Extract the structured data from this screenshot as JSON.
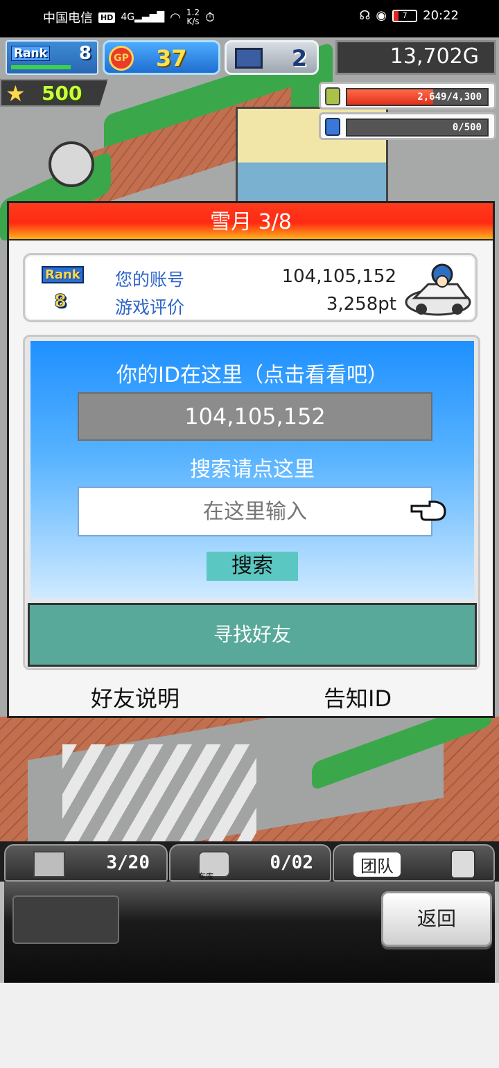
{
  "status_bar": {
    "carrier": "中国电信",
    "hd": "HD",
    "network": "4G",
    "speed": "1.2\nK/s",
    "battery": "7",
    "time": "20:22"
  },
  "hud": {
    "rank_label": "Rank",
    "rank_value": "8",
    "gp_label": "GP",
    "gp_value": "37",
    "pc_value": "2",
    "money": "13,702G",
    "star_value": "500",
    "resource_1": "2,649/4,300",
    "resource_2": "0/500",
    "resource_1_level": 0.616,
    "resource_2_level": 0
  },
  "dialog": {
    "title": "雪月 3/8",
    "rank_label": "Rank",
    "rank_value": "8",
    "account_label": "您的账号",
    "account_value": "104,105,152",
    "rating_label": "游戏评价",
    "rating_value": "3,258pt",
    "id_prompt": "你的ID在这里（点击看看吧）",
    "id_value": "104,105,152",
    "search_prompt": "搜索请点这里",
    "search_placeholder": "在这里输入",
    "search_button": "搜索",
    "find_friends_button": "寻找好友",
    "friend_info_link": "好友说明",
    "tell_id_link": "告知ID"
  },
  "bottom_bar": {
    "tab1_count": "3/20",
    "tab2_sub": "车库",
    "tab2_count": "0/02",
    "team_label": "团队",
    "back_button": "返回"
  },
  "colors": {
    "title_red": "#ff2a14",
    "find_green": "#58a99a",
    "search_cyan": "#5bc7c2",
    "panel_blue": "#1f90ff"
  }
}
